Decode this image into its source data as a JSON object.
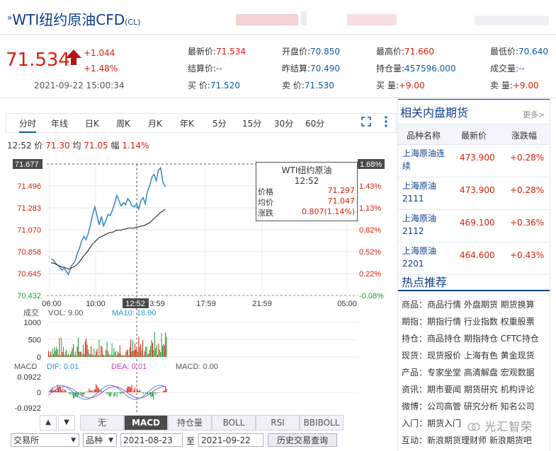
{
  "header": {
    "title": "WTI纽约原油CFD",
    "code": "(CL)",
    "price": "71.534",
    "change": "+1.044",
    "change_pct": "+1.48%",
    "timestamp": "2021-09-22 15:00:34"
  },
  "quotes": [
    {
      "label": "最新价:",
      "value": "71.534"
    },
    {
      "label": "开盘价:",
      "value": "70.850"
    },
    {
      "label": "最高价:",
      "value": "71.660"
    },
    {
      "label": "最低价:",
      "value": "70.640"
    },
    {
      "label": "结算价:",
      "value": "--"
    },
    {
      "label": "昨结算:",
      "value": "70.490"
    },
    {
      "label": "持仓量:",
      "value": "457596.000"
    },
    {
      "label": "成交量:",
      "value": "--"
    },
    {
      "label": "买  价:",
      "value": "71.520"
    },
    {
      "label": "卖  价:",
      "value": "71.530"
    },
    {
      "label": "买  量:",
      "value": "+9.00"
    },
    {
      "label": "卖  量:",
      "value": "+9.00"
    }
  ],
  "chart_tabs": [
    "分时",
    "年线",
    "日K",
    "周K",
    "月K",
    "年K",
    "5分",
    "15分",
    "30分",
    "60分"
  ],
  "info_line": {
    "time": "12:52",
    "price_label": "价",
    "price": "71.30",
    "avg_label": "均",
    "avg": "71.05",
    "range_label": "幅",
    "range": "1.14%"
  },
  "chart_data": {
    "type": "line",
    "y_ticks_left": [
      "71.677",
      "71.496",
      "71.283",
      "71.070",
      "70.858",
      "70.645",
      "70.432"
    ],
    "y_ticks_right": [
      "1.68%",
      "1.43%",
      "1.13%",
      "0.82%",
      "0.52%",
      "0.22%",
      "-0.08%"
    ],
    "x_ticks": [
      "06:00",
      "10:00",
      "12:52",
      "17:59",
      "21:59",
      "05:00"
    ],
    "x_tick_partial": "3:59",
    "series": [
      {
        "values": [
          70.78,
          70.77,
          70.74,
          70.72,
          70.7,
          70.67,
          70.69,
          70.66,
          70.63,
          70.7,
          70.73,
          70.76,
          70.83,
          70.88,
          70.95,
          70.99,
          70.96,
          71.02,
          71.1,
          71.2,
          71.27,
          71.19,
          71.1,
          71.18,
          71.09,
          71.14,
          71.2,
          71.19,
          71.24,
          71.3,
          71.38,
          71.33,
          71.28,
          71.31,
          71.29,
          71.35,
          71.32,
          71.28,
          71.27,
          71.3,
          71.25,
          71.33,
          71.36,
          71.3,
          71.42,
          71.47,
          71.55,
          71.58,
          71.52,
          71.62,
          71.64,
          71.51,
          71.46
        ]
      },
      {
        "values": [
          70.74,
          70.74,
          70.73,
          70.72,
          70.71,
          70.7,
          70.7,
          70.69,
          70.68,
          70.69,
          70.7,
          70.71,
          70.73,
          70.75,
          70.78,
          70.81,
          70.83,
          70.86,
          70.89,
          70.92,
          70.94,
          70.96,
          70.98,
          70.99,
          71.0,
          71.01,
          71.02,
          71.03,
          71.03,
          71.04,
          71.05,
          71.05,
          71.05,
          71.06,
          71.06,
          71.07,
          71.07,
          71.07,
          71.07,
          71.08,
          71.08,
          71.09,
          71.09,
          71.1,
          71.11,
          71.12,
          71.14,
          71.16,
          71.18,
          71.2,
          71.22,
          71.23,
          71.25
        ]
      }
    ],
    "ylim": [
      70.432,
      71.677
    ]
  },
  "tooltip": {
    "title": "WTI纽约原油",
    "time": "12:52",
    "rows": [
      {
        "label": "价格",
        "value": "71.297"
      },
      {
        "label": "均价",
        "value": "71.047"
      },
      {
        "label": "涨跌",
        "value": "0.807(1.14%)"
      }
    ]
  },
  "volume": {
    "label": "成交",
    "vol_text": "VOL: 9.00",
    "ma_text": "MA10: 18.90",
    "ticks": [
      "1000",
      "500",
      "0"
    ]
  },
  "macd": {
    "label": "MACD",
    "dif": "DIF: 0.01",
    "dea": "DEA: 0.01",
    "macd": "MACD: 0.00",
    "ticks": [
      "0.0922",
      "0",
      "-0.0922"
    ]
  },
  "indicator_tabs": [
    "无",
    "MACD",
    "持仓量",
    "BOLL",
    "RSI",
    "BBIBOLL"
  ],
  "query": {
    "exchange": "交易所",
    "variety": "品种",
    "start": "2021-08-23",
    "to": "至",
    "end": "2021-09-22",
    "button": "历史交易查询"
  },
  "related": {
    "title": "相关内盘期货",
    "more": "更多>",
    "columns": [
      "品种名称",
      "最新价",
      "涨跌幅"
    ],
    "rows": [
      {
        "name": "上海原油连续",
        "price": "473.900",
        "pct": "+0.28%"
      },
      {
        "name": "上海原油2111",
        "price": "473.900",
        "pct": "+0.28%"
      },
      {
        "name": "上海原油2112",
        "price": "469.100",
        "pct": "+0.36%"
      },
      {
        "name": "上海原油2201",
        "price": "464.600",
        "pct": "+0.43%"
      }
    ]
  },
  "hot": {
    "title": "热点推荐",
    "rows": [
      "商品：商品行情 外盘期货 期货换算",
      "期指：期指行情 行业指数 权重股票",
      "持仓：商品持仓 期指持仓 CFTC持仓",
      "现货：现货报价 上海有色 黄金现货",
      "产品：专家坐堂 高清解盘 宏观数据",
      "资讯：期市要闻 期货研究 机构评论",
      "微博：公司高管 研究分析 知名公司",
      "入门：期货入门",
      "互动：新浪期货理财师 新浪期货吧"
    ]
  },
  "colors": {
    "up": "#d81e06",
    "down": "#1a9e3a",
    "price_line": "#2f87c0",
    "avg_line": "#333333",
    "brand": "#0d3f8c"
  }
}
